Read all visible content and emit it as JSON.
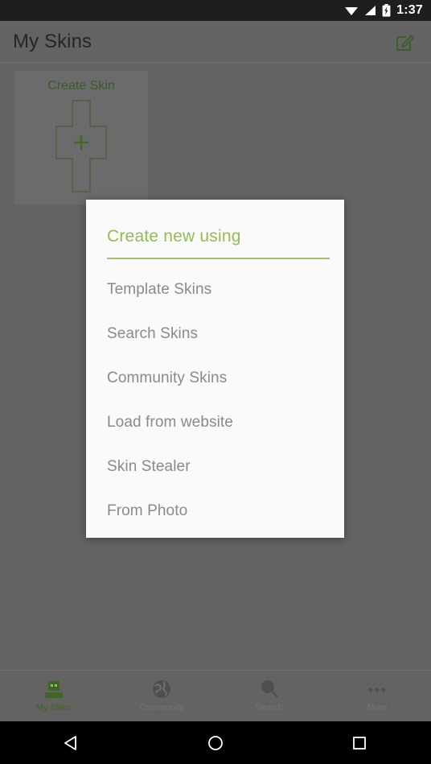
{
  "status_bar": {
    "time": "1:37",
    "icons": [
      "wifi-icon",
      "cellular-signal-icon",
      "battery-charging-icon"
    ]
  },
  "app_bar": {
    "title": "My Skins",
    "edit_icon": "edit-pencil-icon"
  },
  "content": {
    "create_skin_card": {
      "label": "Create Skin",
      "shape_icon": "skin-template-cross-icon",
      "plus_icon": "plus-icon"
    }
  },
  "dialog": {
    "title": "Create new using",
    "items": [
      {
        "label": "Template Skins"
      },
      {
        "label": "Search Skins"
      },
      {
        "label": "Community Skins"
      },
      {
        "label": "Load from website"
      },
      {
        "label": "Skin Stealer"
      },
      {
        "label": "From Photo"
      }
    ]
  },
  "bottom_nav": {
    "items": [
      {
        "label": "My Skins",
        "icon": "minecraft-head-icon",
        "active": true
      },
      {
        "label": "Community",
        "icon": "globe-icon",
        "active": false
      },
      {
        "label": "Search",
        "icon": "magnifier-icon",
        "active": false
      },
      {
        "label": "More",
        "icon": "overflow-dots-icon",
        "active": false
      }
    ]
  },
  "android_nav": {
    "back_label": "Back",
    "home_label": "Home",
    "recents_label": "Recents"
  },
  "colors": {
    "scrim": "#636363",
    "dialog_background": "#fafafa",
    "accent_green": "#8fbf4e",
    "divider_green": "#9ec46a",
    "item_text": "#8a8a8a",
    "status_bar": "#1e1e1e"
  }
}
